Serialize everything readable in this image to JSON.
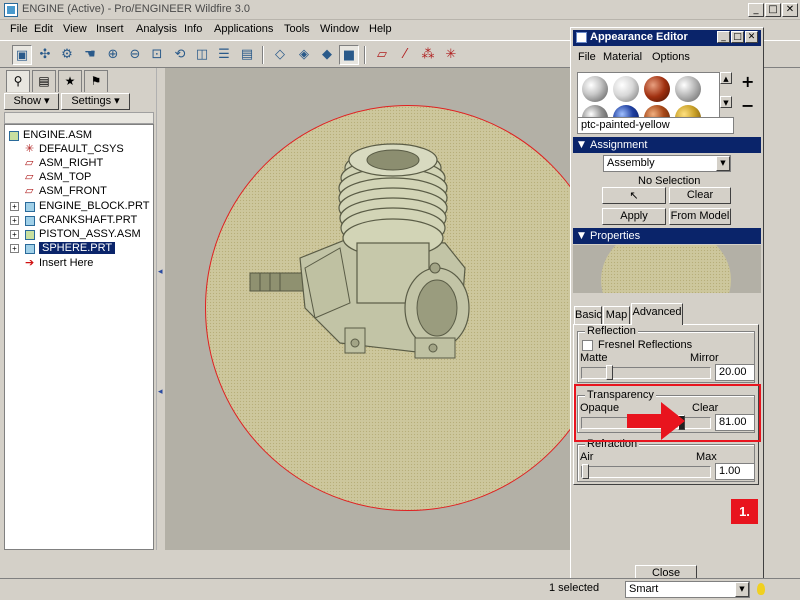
{
  "window": {
    "title": "ENGINE (Active) - Pro/ENGINEER Wildfire 3.0",
    "minimize": "_",
    "maximize": "□",
    "close": "✕"
  },
  "menu": [
    "File",
    "Edit",
    "View",
    "Insert",
    "Analysis",
    "Info",
    "Applications",
    "Tools",
    "Window",
    "Help"
  ],
  "toolbar_icons": [
    "repaint-icon",
    "spin-center-icon",
    "orient-icon",
    "pan-icon",
    "zoom-in-icon",
    "zoom-out-icon",
    "refit-icon",
    "reorient-icon",
    "saved-views-icon",
    "layers-icon",
    "view-manager-icon",
    "wireframe-icon",
    "hidden-line-icon",
    "no-hidden-icon",
    "shading-icon",
    "datum-planes-icon",
    "datum-axes-icon",
    "datum-points-icon",
    "csys-icon"
  ],
  "model_tree": {
    "show_label": "Show ▾",
    "settings_label": "Settings ▾",
    "items": [
      {
        "label": "ENGINE.ASM",
        "icon": "assembly-icon"
      },
      {
        "label": "DEFAULT_CSYS",
        "icon": "csys-icon"
      },
      {
        "label": "ASM_RIGHT",
        "icon": "datum-plane-icon"
      },
      {
        "label": "ASM_TOP",
        "icon": "datum-plane-icon"
      },
      {
        "label": "ASM_FRONT",
        "icon": "datum-plane-icon"
      },
      {
        "label": "ENGINE_BLOCK.PRT",
        "icon": "part-icon"
      },
      {
        "label": "CRANKSHAFT.PRT",
        "icon": "part-icon"
      },
      {
        "label": "PISTON_ASSY.ASM",
        "icon": "assembly-icon"
      },
      {
        "label": "SPHERE.PRT",
        "icon": "part-icon"
      },
      {
        "label": "Insert Here",
        "icon": "insert-arrow-icon"
      }
    ]
  },
  "appearance_editor": {
    "title": "Appearance Editor",
    "menu": [
      "File",
      "Material",
      "Options"
    ],
    "add_label": "+",
    "remove_label": "−",
    "swatch_colors": [
      "#c8c8c8",
      "#d8d8d8",
      "#a03010",
      "#b8b8b8",
      "#909090",
      "#2040a0",
      "#a84818",
      "#c8a028"
    ],
    "material_name": "ptc-painted-yellow",
    "assignment": {
      "header": "Assignment",
      "type_value": "Assembly",
      "selection_status": "No Selection",
      "clear_label": "Clear",
      "apply_label": "Apply",
      "from_model_label": "From Model"
    },
    "properties": {
      "header": "Properties",
      "tabs": [
        "Basic",
        "Map",
        "Advanced"
      ],
      "active_tab": "Advanced",
      "reflection": {
        "group_label": "Reflection",
        "fresnel_label": "Fresnel Reflections",
        "fresnel_checked": false,
        "min_label": "Matte",
        "max_label": "Mirror",
        "value": "20.00"
      },
      "transparency": {
        "group_label": "Transparency",
        "min_label": "Opaque",
        "max_label": "Clear",
        "value": "81.00"
      },
      "refraction": {
        "group_label": "Refraction",
        "min_label": "Air",
        "max_label": "Max",
        "value": "1.00"
      }
    },
    "close_label": "Close",
    "step_badge": "1."
  },
  "status_bar": {
    "selected": "1 selected",
    "filter": "Smart"
  },
  "colors": {
    "highlight": "#e8141e",
    "titlebar": "#0a246a",
    "sphere": "#cdc79d"
  }
}
